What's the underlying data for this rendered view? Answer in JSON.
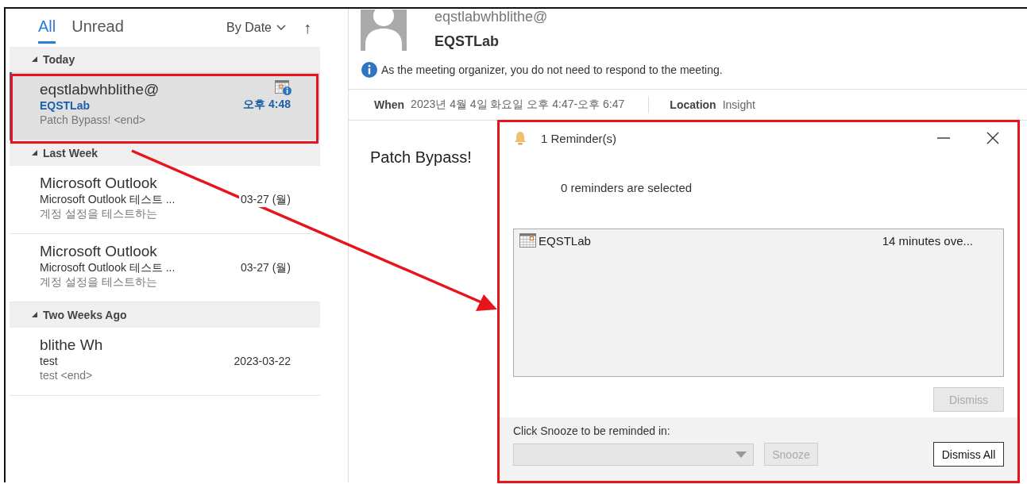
{
  "mail_list": {
    "filters": [
      {
        "label": "All",
        "selected": true
      },
      {
        "label": "Unread",
        "selected": false
      }
    ],
    "sort": "By Date",
    "sort_direction": "↑",
    "groups": [
      {
        "label": "Today",
        "expanded": true,
        "items": [
          {
            "kind": "meeting",
            "sender": "eqstlabwhblithe@",
            "subject": "EQSTLab",
            "preview": "Patch Bypass!  <end>",
            "time": "오후 4:48",
            "selected": true,
            "unread": true
          }
        ]
      },
      {
        "label": "Last Week",
        "expanded": true,
        "items": [
          {
            "kind": "mail",
            "sender": "Microsoft Outlook",
            "subject": "Microsoft Outlook 테스트 ...",
            "preview": "계정 설정을 테스트하는",
            "time": "03-27 (월)",
            "selected": false,
            "unread": false
          },
          {
            "kind": "mail",
            "sender": "Microsoft Outlook",
            "subject": "Microsoft Outlook 테스트 ...",
            "preview": "계정 설정을 테스트하는",
            "time": "03-27 (월)",
            "selected": false,
            "unread": false
          }
        ]
      },
      {
        "label": "Two Weeks Ago",
        "expanded": true,
        "items": [
          {
            "kind": "mail",
            "sender": "blithe Wh",
            "subject": "test",
            "preview": "test <end>",
            "time": "2023-03-22",
            "selected": false,
            "unread": false
          }
        ]
      }
    ]
  },
  "reading_pane": {
    "sender_address": "eqstlabwhblithe@",
    "sender_name": "EQSTLab",
    "info": "As the meeting organizer, you do not need to respond to the meeting.",
    "when_label": "When",
    "when": "2023년 4월 4일 화요일 오후 4:47-오후 6:47",
    "location_label": "Location",
    "location": "Insight",
    "body": "Patch Bypass!"
  },
  "reminder_dialog": {
    "title": "1 Reminder(s)",
    "status": "0 reminders are selected",
    "reminders": [
      {
        "subject": "EQSTLab",
        "due": "14 minutes ove...",
        "selected": false
      }
    ],
    "dismiss": {
      "label": "Dismiss",
      "disabled": true
    },
    "snooze_label": "Click Snooze to be reminded in:",
    "snooze_choice": {
      "disabled": true
    },
    "snooze": {
      "label": "Snooze",
      "disabled": true
    },
    "dismiss_all": {
      "label": "Dismiss All",
      "disabled": false
    }
  }
}
